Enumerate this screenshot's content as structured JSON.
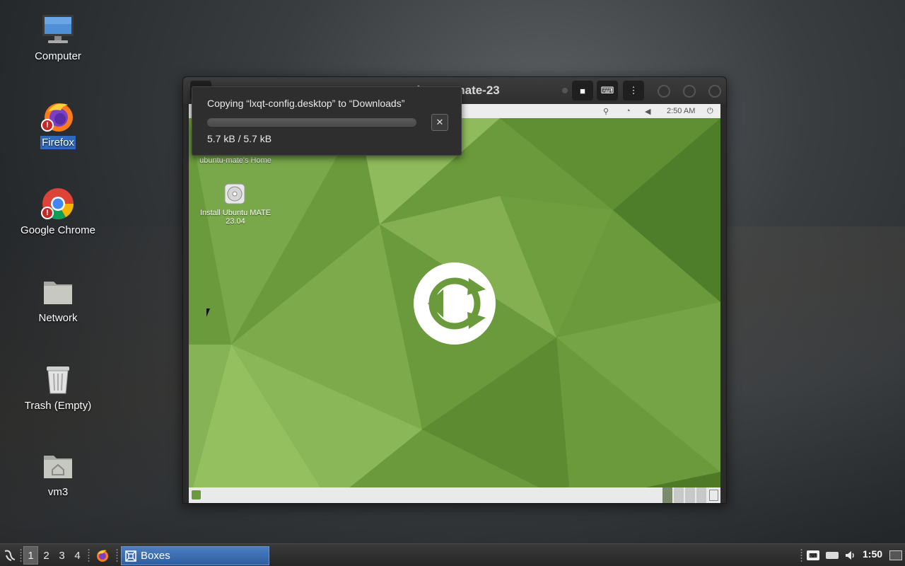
{
  "desktop": {
    "icons": [
      {
        "label": "Computer",
        "icon": "computer-icon"
      },
      {
        "label": "Firefox",
        "icon": "firefox-icon",
        "selected": true
      },
      {
        "label": "Google Chrome",
        "icon": "chrome-icon"
      },
      {
        "label": "Network",
        "icon": "folder-icon"
      },
      {
        "label": "Trash (Empty)",
        "icon": "trash-icon"
      },
      {
        "label": "vm3",
        "icon": "home-folder-icon"
      }
    ]
  },
  "vm_window": {
    "title": "ubuntu-mate-23",
    "guest": {
      "clock": "2:50 AM",
      "desktop_icons": [
        {
          "label": "ubuntu-mate's Home"
        },
        {
          "label": "Install Ubuntu MATE 23.04"
        }
      ]
    }
  },
  "copy_dialog": {
    "message": "Copying “lxqt-config.desktop” to “Downloads”",
    "size": "5.7 kB / 5.7 kB",
    "progress": 1.0
  },
  "taskbar": {
    "workspaces": [
      "1",
      "2",
      "3",
      "4"
    ],
    "active_workspace": "1",
    "task": "Boxes",
    "clock": "1:50"
  },
  "colors": {
    "selection": "#2f6bbd",
    "task_button": "#2e5fa3",
    "guest_wallpaper": "#6a9a3c"
  }
}
